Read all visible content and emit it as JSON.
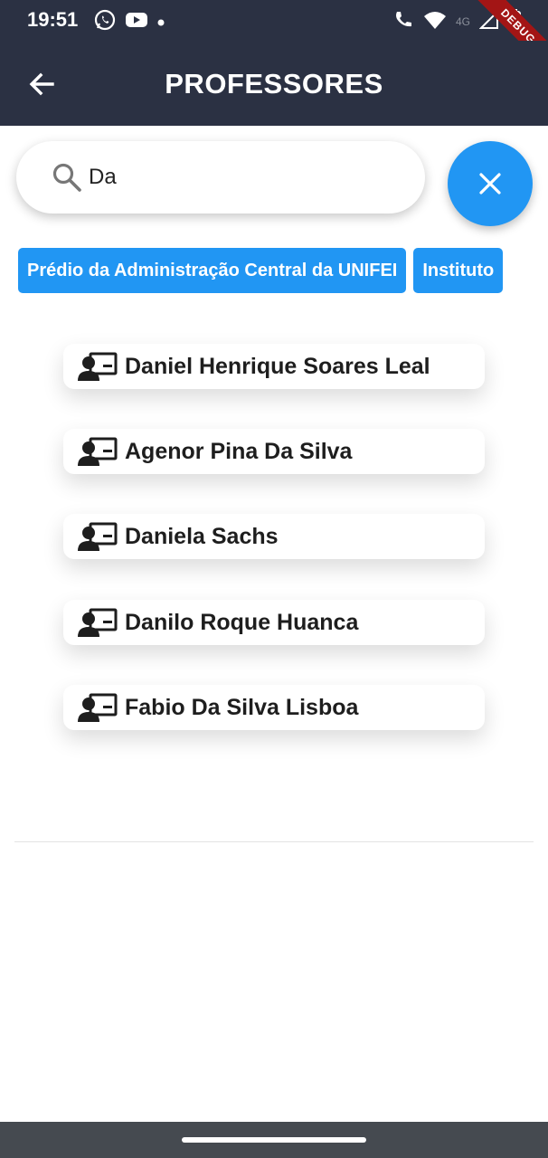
{
  "status_bar": {
    "time": "19:51",
    "left_icons": [
      "whatsapp-icon",
      "youtube-icon",
      "dot-icon"
    ],
    "right_icons": [
      "volte-call-icon",
      "wifi-icon",
      "signal-icon",
      "battery-icon"
    ],
    "network_label": "4G",
    "debug_banner": "DEBUG"
  },
  "app_bar": {
    "title": "PROFESSORES",
    "back_icon": "arrow-back-icon"
  },
  "search": {
    "value": "Da",
    "icon": "search-icon"
  },
  "fab": {
    "icon": "close-icon",
    "color": "#2196f3"
  },
  "chips": [
    {
      "label": "Prédio da Administração Central da UNIFEI"
    },
    {
      "label": "Instituto"
    }
  ],
  "professors": [
    {
      "name": "Daniel Henrique Soares Leal",
      "icon": "teacher-icon"
    },
    {
      "name": "Agenor Pina Da Silva",
      "icon": "teacher-icon"
    },
    {
      "name": "Daniela Sachs",
      "icon": "teacher-icon"
    },
    {
      "name": "Danilo Roque Huanca",
      "icon": "teacher-icon"
    },
    {
      "name": "Fabio Da Silva Lisboa",
      "icon": "teacher-icon"
    }
  ],
  "colors": {
    "app_bar": "#2b3143",
    "accent": "#2196f3",
    "nav_bar": "#454a50"
  }
}
